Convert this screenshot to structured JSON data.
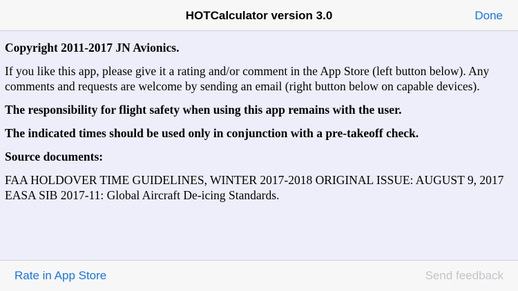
{
  "navbar": {
    "title": "HOTCalculator version 3.0",
    "done_label": "Done"
  },
  "content": {
    "copyright": "Copyright 2011-2017 JN Avionics.",
    "intro": "If you like this app, please give it a rating and/or comment in the App Store (left button below). Any comments and requests are welcome by sending an email (right button below on capable devices).",
    "responsibility": "The responsibility for flight safety when using this app remains with the user.",
    "indicated_times": "The indicated times should be used only in conjunction with a pre-takeoff check.",
    "sources_heading": "Source documents:",
    "sources": [
      "FAA HOLDOVER TIME GUIDELINES, WINTER 2017-2018 ORIGINAL ISSUE: AUGUST 9, 2017",
      "EASA SIB 2017-11: Global Aircraft De-icing Standards."
    ]
  },
  "toolbar": {
    "rate_label": "Rate in App Store",
    "feedback_label": "Send feedback",
    "feedback_enabled": false
  },
  "colors": {
    "accent": "#1a73e8",
    "disabled": "#c4c4c8",
    "content_background": "#edeefa",
    "bar_background": "#f7f7f7"
  }
}
